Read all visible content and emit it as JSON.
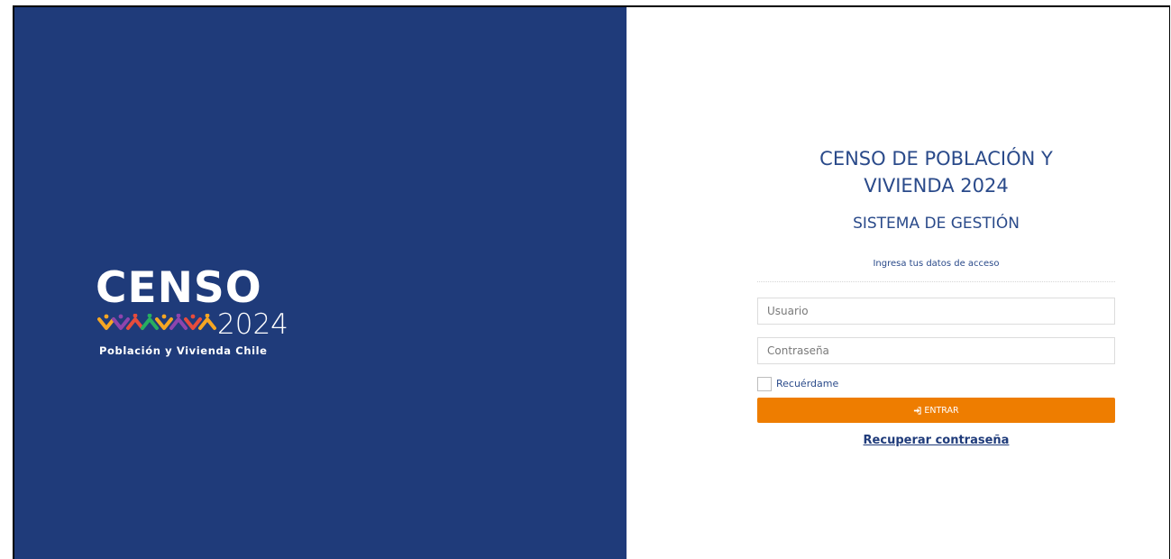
{
  "brand": {
    "logo_word": "CENSO",
    "logo_year": "2024",
    "logo_subtitle": "Población y Vivienda Chile",
    "panel_color": "#1f3b7a",
    "logo_people_colors": [
      "#f5a623",
      "#8e44ad",
      "#e74c3c",
      "#27ae60",
      "#f5a623",
      "#8e44ad",
      "#e74c3c",
      "#f5a623"
    ]
  },
  "login": {
    "title_line1": "CENSO DE POBLACIÓN Y",
    "title_line2": "VIVIENDA 2024",
    "subtitle": "SISTEMA DE GESTIÓN",
    "hint": "Ingresa tus datos de acceso",
    "username_placeholder": "Usuario",
    "password_placeholder": "Contraseña",
    "remember_label": "Recuérdame",
    "enter_label": "ENTRAR",
    "enter_icon": "sign-in-icon",
    "recover_label": "Recuperar contraseña",
    "accent_color": "#ee7d00",
    "text_color": "#2a4a8a"
  }
}
